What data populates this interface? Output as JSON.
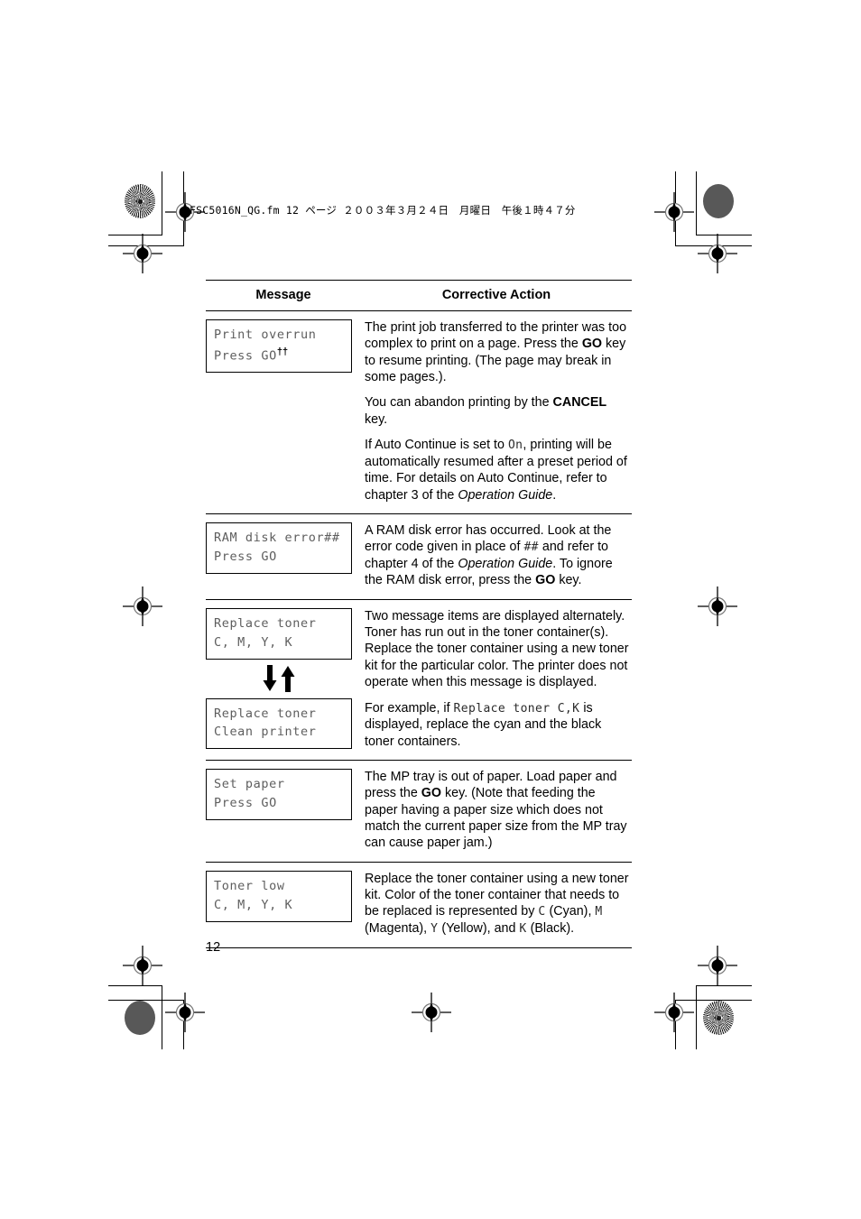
{
  "document": {
    "slug_line": "FSC5016N_QG.fm  12 ページ  ２００３年３月２４日　月曜日　午後１時４７分",
    "page_number": "12"
  },
  "table": {
    "headers": {
      "message": "Message",
      "corrective_action": "Corrective Action"
    },
    "rows": [
      {
        "id": "print-overrun",
        "lcd_line1": "Print overrun",
        "lcd_line2": "Press GO",
        "lcd_superscript": "††",
        "paragraphs": [
          {
            "parts": [
              {
                "t": "The print job transferred to the printer was too complex to print on a page. Press the ",
                "s": "plain"
              },
              {
                "t": "GO",
                "s": "bold"
              },
              {
                "t": " key to resume printing. (The page may break in some pages.).",
                "s": "plain"
              }
            ]
          },
          {
            "parts": [
              {
                "t": "You can abandon printing by the ",
                "s": "plain"
              },
              {
                "t": "CANCEL",
                "s": "bold"
              },
              {
                "t": " key.",
                "s": "plain"
              }
            ]
          },
          {
            "parts": [
              {
                "t": "If Auto Continue is set to ",
                "s": "plain"
              },
              {
                "t": "On",
                "s": "mono"
              },
              {
                "t": ", printing will be automatically resumed after a preset period of time. For details on Auto Continue, refer to chapter 3 of the ",
                "s": "plain"
              },
              {
                "t": "Operation Guide",
                "s": "italic"
              },
              {
                "t": ".",
                "s": "plain"
              }
            ]
          }
        ]
      },
      {
        "id": "ram-disk-error",
        "lcd_line1": "RAM disk error##",
        "lcd_line2": "Press GO",
        "lcd_superscript": "",
        "paragraphs": [
          {
            "parts": [
              {
                "t": "A RAM disk error has occurred. Look at the error code given in place of ",
                "s": "plain"
              },
              {
                "t": "##",
                "s": "mono"
              },
              {
                "t": " and refer to chapter 4 of the ",
                "s": "plain"
              },
              {
                "t": "Operation Guide",
                "s": "italic"
              },
              {
                "t": ". To ignore the RAM disk error, press the ",
                "s": "plain"
              },
              {
                "t": "GO",
                "s": "bold"
              },
              {
                "t": " key.",
                "s": "plain"
              }
            ]
          }
        ]
      },
      {
        "id": "replace-toner",
        "lcd_line1": "Replace toner",
        "lcd_line2": "C, M, Y, K",
        "lcd_superscript": "",
        "alternating": true,
        "arrow_down_icon": "arrow-down-icon",
        "arrow_up_icon": "arrow-up-icon",
        "lcd2_line1": "Replace toner",
        "lcd2_line2": "Clean printer",
        "paragraphs": [
          {
            "parts": [
              {
                "t": "Two message items are displayed alternately. Toner has run out in the toner container(s). Replace the toner container using a new toner kit for the particular color. The printer does not operate when this message is displayed.",
                "s": "plain"
              }
            ]
          },
          {
            "parts": [
              {
                "t": "For example, if ",
                "s": "plain"
              },
              {
                "t": "Replace toner C,K",
                "s": "mono"
              },
              {
                "t": " is displayed, replace the cyan and the black toner containers.",
                "s": "plain"
              }
            ]
          }
        ]
      },
      {
        "id": "set-paper",
        "lcd_line1": "Set paper",
        "lcd_line2": "Press GO",
        "lcd_superscript": "",
        "paragraphs": [
          {
            "parts": [
              {
                "t": "The MP tray is out of paper. Load paper and press the ",
                "s": "plain"
              },
              {
                "t": "GO",
                "s": "bold"
              },
              {
                "t": " key. (Note that feeding the paper having a paper size which does not match the current paper size from the MP tray can cause paper jam.)",
                "s": "plain"
              }
            ]
          }
        ]
      },
      {
        "id": "toner-low",
        "lcd_line1": "Toner low",
        "lcd_line2": "C, M, Y, K",
        "lcd_superscript": "",
        "paragraphs": [
          {
            "parts": [
              {
                "t": "Replace the toner container using a new toner kit. Color of the toner container that needs to be replaced is represented by ",
                "s": "plain"
              },
              {
                "t": "C",
                "s": "mono"
              },
              {
                "t": " (Cyan), ",
                "s": "plain"
              },
              {
                "t": "M",
                "s": "mono"
              },
              {
                "t": " (Magenta), ",
                "s": "plain"
              },
              {
                "t": "Y",
                "s": "mono"
              },
              {
                "t": " (Yellow), and ",
                "s": "plain"
              },
              {
                "t": "K",
                "s": "mono"
              },
              {
                "t": " (Black).",
                "s": "plain"
              }
            ]
          }
        ]
      }
    ]
  },
  "prepress": {
    "registration_mark_icon": "registration-target-icon",
    "halftone_dot_icon": "halftone-dot-icon",
    "solid_dot_icon": "solid-dot-icon",
    "colors": {
      "ink": "#000000",
      "lcd_text": "#5e5e5e",
      "dot_gray": "#585858"
    }
  }
}
